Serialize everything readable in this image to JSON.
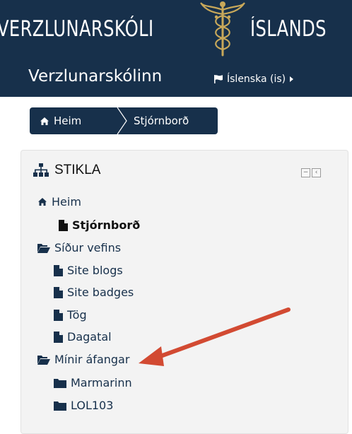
{
  "header": {
    "logo_left": "VERZLUNARSKÓLI",
    "logo_right": "ÍSLANDS",
    "site_name": "Verzlunarskólinn",
    "language": "Íslenska (is)",
    "language_flag_icon": "flag-icon",
    "language_caret_icon": "caret-right-icon"
  },
  "breadcrumb": {
    "home_label": "Heim",
    "home_icon": "home-icon",
    "current_label": "Stjórnborð"
  },
  "navigation_block": {
    "title": "STIKLA",
    "title_icon": "sitemap-icon",
    "items": [
      {
        "label": "Heim",
        "icon": "home-icon"
      },
      {
        "label": "Stjórnborð",
        "icon": "file-icon",
        "current": true
      },
      {
        "label": "Síður vefins",
        "icon": "folder-open-icon"
      },
      {
        "label": "Site blogs",
        "icon": "file-icon"
      },
      {
        "label": "Site badges",
        "icon": "file-icon"
      },
      {
        "label": "Tög",
        "icon": "file-icon"
      },
      {
        "label": "Dagatal",
        "icon": "file-icon"
      },
      {
        "label": "Mínir áfangar",
        "icon": "folder-open-icon"
      },
      {
        "label": "Marmarinn",
        "icon": "folder-icon"
      },
      {
        "label": "LOL103",
        "icon": "folder-icon"
      }
    ]
  },
  "colors": {
    "brand_navy": "#17304b",
    "annotation_arrow": "#d24a32",
    "block_background": "#f3f3f3"
  }
}
